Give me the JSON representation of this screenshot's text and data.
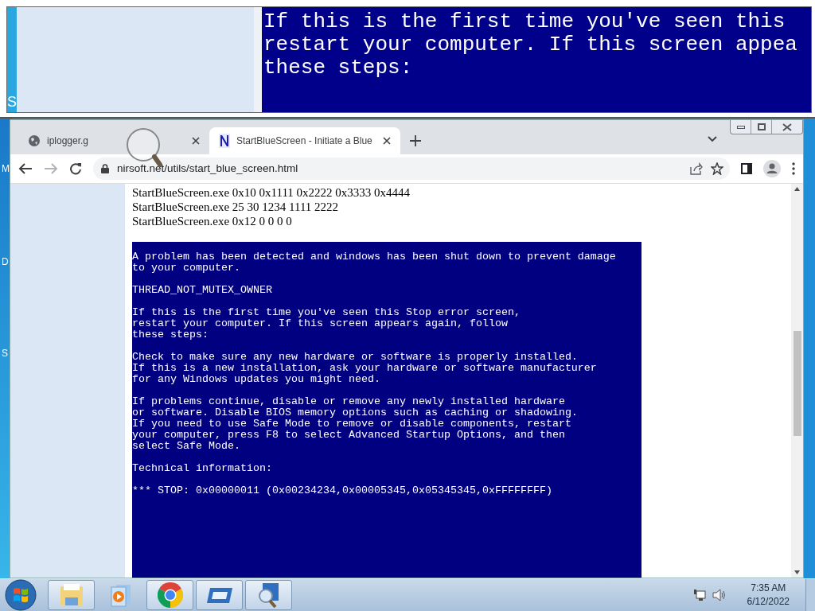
{
  "magnifier": {
    "side_label": "S",
    "lines": [
      "If this is the first time you've seen this",
      "restart your computer. If this screen appea",
      "these steps:"
    ]
  },
  "desktop": {
    "icon_labels": [
      "M",
      "D",
      "S"
    ]
  },
  "browser": {
    "tabs": [
      {
        "title": "iplogger.g",
        "selected": false
      },
      {
        "title": "StartBlueScreen - Initiate a Blue",
        "selected": true
      }
    ],
    "address": "nirsoft.net/utils/start_blue_screen.html",
    "commands": [
      "StartBlueScreen.exe 0x10 0x1111 0x2222 0x3333 0x4444",
      "StartBlueScreen.exe 25 30 1234 1111 2222",
      "StartBlueScreen.exe 0x12 0 0 0 0"
    ],
    "bsod": [
      "A problem has been detected and windows has been shut down to prevent damage\nto your computer.",
      "THREAD_NOT_MUTEX_OWNER",
      "If this is the first time you've seen this Stop error screen,\nrestart your computer. If this screen appears again, follow\nthese steps:",
      "Check to make sure any new hardware or software is properly installed.\nIf this is a new installation, ask your hardware or software manufacturer\nfor any Windows updates you might need.",
      "If problems continue, disable or remove any newly installed hardware\nor software. Disable BIOS memory options such as caching or shadowing.\nIf you need to use Safe Mode to remove or disable components, restart\nyour computer, press F8 to select Advanced Startup Options, and then\nselect Safe Mode.",
      "Technical information:",
      "*** STOP: 0x00000011 (0x00234234,0x00005345,0x05345345,0xFFFFFFFF)"
    ]
  },
  "taskbar": {
    "apps": [
      {
        "kind": "folder",
        "running": true
      },
      {
        "kind": "media",
        "running": false
      },
      {
        "kind": "chrome",
        "running": true
      },
      {
        "kind": "window",
        "running": true
      },
      {
        "kind": "magnifier",
        "running": true
      }
    ],
    "clock": {
      "time": "7:35 AM",
      "date": "6/12/2022"
    }
  }
}
